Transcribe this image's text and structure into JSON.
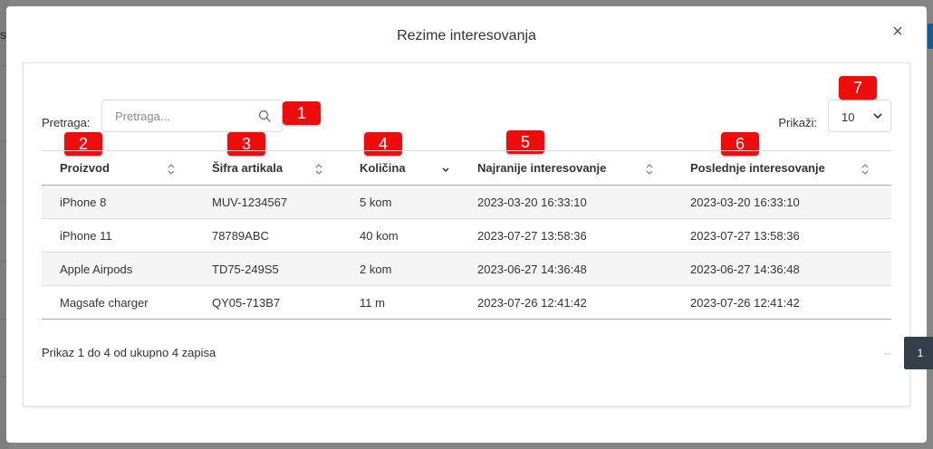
{
  "backdrop": {
    "text": "s"
  },
  "modal": {
    "title": "Rezime interesovanja",
    "close_label": "×"
  },
  "search": {
    "label": "Pretraga:",
    "placeholder": "Pretraga...",
    "icon": "search-icon"
  },
  "page_size": {
    "label": "Prikaži:",
    "selected": "10"
  },
  "badges": [
    "1",
    "2",
    "3",
    "4",
    "5",
    "6",
    "7"
  ],
  "table": {
    "columns": [
      {
        "label": "Proizvod",
        "sort": "none"
      },
      {
        "label": "Šifra artikala",
        "sort": "none"
      },
      {
        "label": "Količina",
        "sort": "desc"
      },
      {
        "label": "Najranije interesovanje",
        "sort": "none"
      },
      {
        "label": "Poslednje interesovanje",
        "sort": "none"
      }
    ],
    "rows": [
      [
        "iPhone 8",
        "MUV-1234567",
        "5 kom",
        "2023-03-20 16:33:10",
        "2023-03-20 16:33:10"
      ],
      [
        "iPhone 11",
        "78789ABC",
        "40 kom",
        "2023-07-27 13:58:36",
        "2023-07-27 13:58:36"
      ],
      [
        "Apple Airpods",
        "TD75-249S5",
        "2 kom",
        "2023-06-27 14:36:48",
        "2023-06-27 14:36:48"
      ],
      [
        "Magsafe charger",
        "QY05-713B7",
        "11 m",
        "2023-07-26 12:41:42",
        "2023-07-26 12:41:42"
      ]
    ]
  },
  "footer": {
    "info": "Prikaz 1 do 4 od ukupno 4 zapisa",
    "prev": "←",
    "current_page": "1",
    "next": "→"
  },
  "colors": {
    "badge": "#ee0d0d",
    "active_page": "#343f49",
    "striped_row": "#f5f5f5"
  }
}
